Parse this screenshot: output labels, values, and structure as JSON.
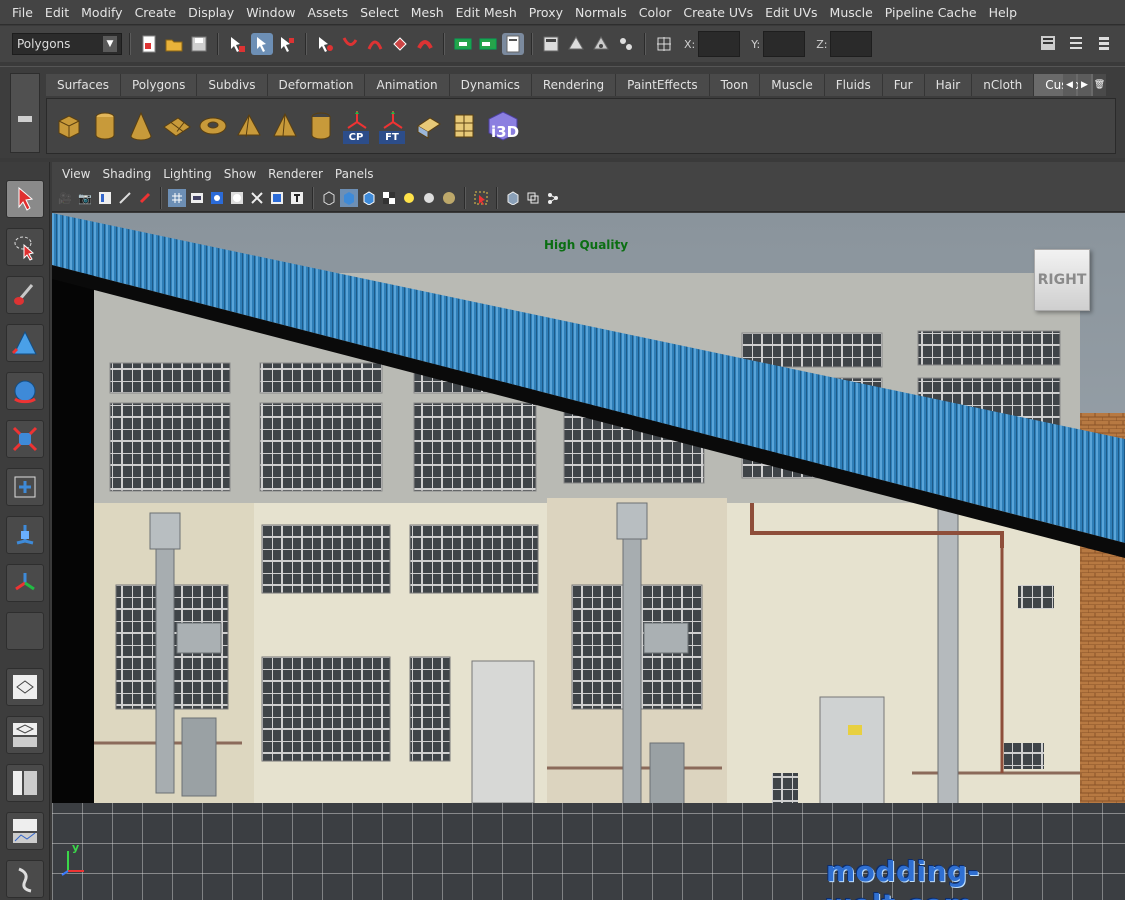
{
  "menubar": {
    "items": [
      "File",
      "Edit",
      "Modify",
      "Create",
      "Display",
      "Window",
      "Assets",
      "Select",
      "Mesh",
      "Edit Mesh",
      "Proxy",
      "Normals",
      "Color",
      "Create UVs",
      "Edit UVs",
      "Muscle",
      "Pipeline Cache",
      "Help"
    ]
  },
  "statusline": {
    "mode": "Polygons",
    "x_label": "X:",
    "y_label": "Y:",
    "z_label": "Z:"
  },
  "shelf": {
    "tabs": [
      "Surfaces",
      "Polygons",
      "Subdivs",
      "Deformation",
      "Animation",
      "Dynamics",
      "Rendering",
      "PaintEffects",
      "Toon",
      "Muscle",
      "Fluids",
      "Fur",
      "Hair",
      "nCloth",
      "Custom"
    ],
    "active_tab": "Custom",
    "icon_labels": {
      "cp": "CP",
      "ft": "FT",
      "i3d": "i3D"
    }
  },
  "panel": {
    "menus": [
      "View",
      "Shading",
      "Lighting",
      "Show",
      "Renderer",
      "Panels"
    ]
  },
  "viewport": {
    "quality_label": "High Quality",
    "viewcube_label": "RIGHT",
    "watermark": "modding-welt.com",
    "axis_y": "y"
  },
  "colors": {
    "roof_blue": "#2f7fb8",
    "quality_green": "#0b6e12",
    "watermark_blue": "#2f6fd1",
    "custom_tab": "#6a6a6a"
  }
}
